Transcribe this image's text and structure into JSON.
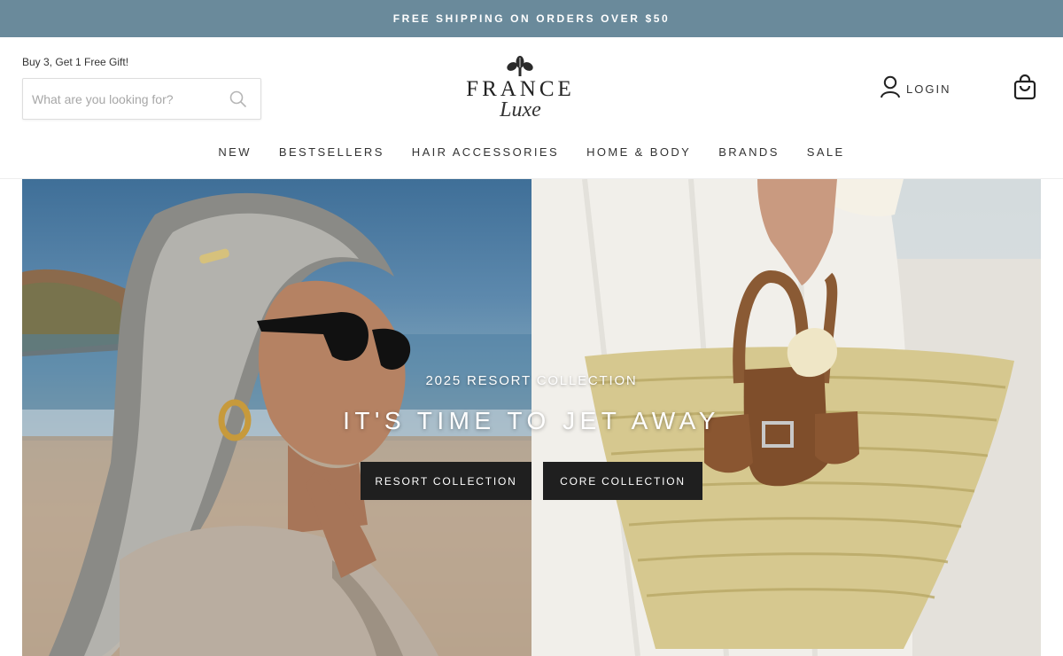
{
  "announcement": {
    "text": "FREE SHIPPING ON ORDERS OVER $50"
  },
  "header": {
    "promo_text": "Buy 3, Get 1 Free Gift!",
    "search": {
      "placeholder": "What are you looking for?",
      "value": ""
    },
    "logo": {
      "word": "FRANCE",
      "script": "Luxe"
    },
    "login_label": "LOGIN"
  },
  "nav": {
    "items": [
      "NEW",
      "BESTSELLERS",
      "HAIR ACCESSORIES",
      "HOME & BODY",
      "BRANDS",
      "SALE"
    ]
  },
  "hero": {
    "eyebrow": "2025 RESORT COLLECTION",
    "headline": "IT'S TIME TO JET AWAY",
    "buttons": {
      "resort": "RESORT COLLECTION",
      "core": "CORE COLLECTION"
    }
  },
  "colors": {
    "announcement_bg": "#6a8a9b",
    "button_bg": "#1f1f1f",
    "text": "#333333"
  },
  "icons": [
    "search-icon",
    "fleur-logo-icon",
    "user-icon",
    "shopping-bag-icon"
  ]
}
